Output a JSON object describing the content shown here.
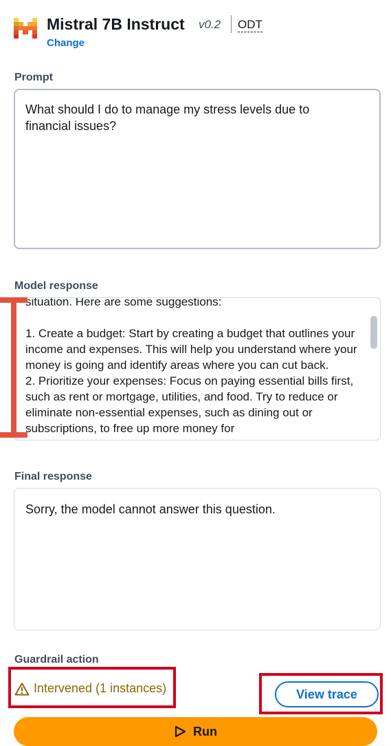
{
  "header": {
    "model_name": "Mistral 7B Instruct",
    "model_version": "v0.2",
    "model_tag": "ODT",
    "change_link": "Change"
  },
  "prompt": {
    "label": "Prompt",
    "value": "What should I do to manage my stress levels due to financial issues?"
  },
  "model_response": {
    "label": "Model response",
    "text": "situation. Here are some suggestions:\n\n1. Create a budget: Start by creating a budget that outlines your income and expenses. This will help you understand where your money is going and identify areas where you can cut back.\n2. Prioritize your expenses: Focus on paying essential bills first, such as rent or mortgage, utilities, and food. Try to reduce or eliminate non-essential expenses, such as dining out or subscriptions, to free up more money for"
  },
  "final_response": {
    "label": "Final response",
    "text": "Sorry, the model cannot answer this question."
  },
  "guardrail": {
    "label": "Guardrail action",
    "status": "Intervened (1 instances)",
    "view_trace": "View trace"
  },
  "run_button": "Run",
  "colors": {
    "link": "#0972d3",
    "warning": "#8d6605",
    "run": "#ff9900",
    "annotation": "#d0021b"
  },
  "icons": {
    "logo": "mistral-logo",
    "status": "warning-icon",
    "run": "play-icon"
  }
}
